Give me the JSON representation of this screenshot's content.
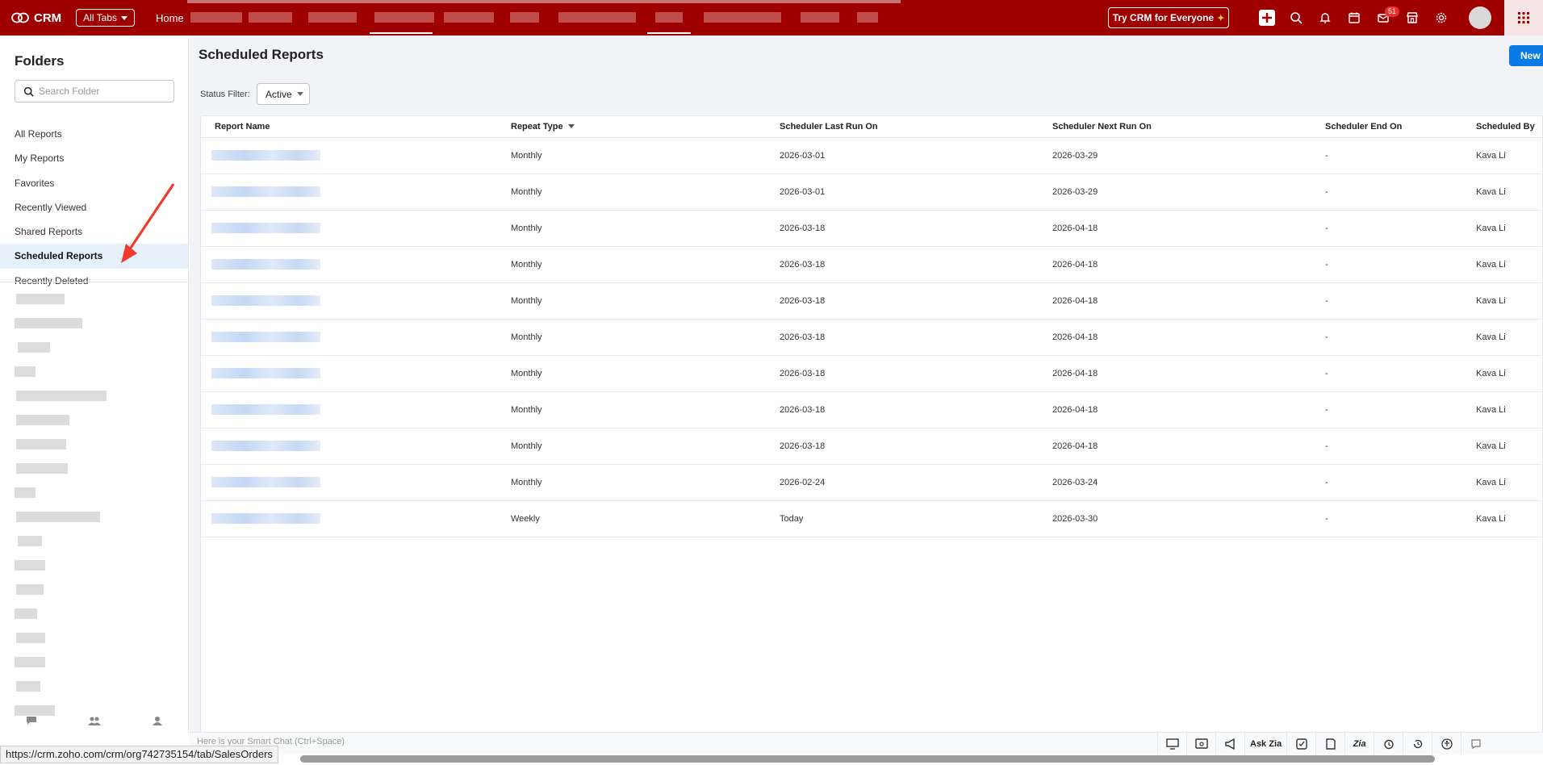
{
  "topbar": {
    "brand": "CRM",
    "all_tabs_label": "All Tabs",
    "home_label": "Home",
    "try_label": "Try CRM for Everyone",
    "notification_count": "51"
  },
  "sidebar": {
    "title": "Folders",
    "search_placeholder": "Search Folder",
    "items": [
      {
        "label": "All Reports"
      },
      {
        "label": "My Reports"
      },
      {
        "label": "Favorites"
      },
      {
        "label": "Recently Viewed"
      },
      {
        "label": "Shared Reports"
      },
      {
        "label": "Scheduled Reports"
      },
      {
        "label": "Recently Deleted"
      }
    ],
    "active_index": 5
  },
  "main": {
    "title": "Scheduled Reports",
    "new_button": "New",
    "status_filter_label": "Status Filter:",
    "status_filter_value": "Active"
  },
  "table": {
    "columns": [
      "Report Name",
      "Repeat Type",
      "Scheduler Last Run On",
      "Scheduler Next Run On",
      "Scheduler End On",
      "Scheduled By"
    ],
    "rows": [
      {
        "repeat": "Monthly",
        "last": "2026-03-01",
        "next": "2026-03-29",
        "end": "-",
        "by": "Kava Li"
      },
      {
        "repeat": "Monthly",
        "last": "2026-03-01",
        "next": "2026-03-29",
        "end": "-",
        "by": "Kava Li"
      },
      {
        "repeat": "Monthly",
        "last": "2026-03-18",
        "next": "2026-04-18",
        "end": "-",
        "by": "Kava Li"
      },
      {
        "repeat": "Monthly",
        "last": "2026-03-18",
        "next": "2026-04-18",
        "end": "-",
        "by": "Kava Li"
      },
      {
        "repeat": "Monthly",
        "last": "2026-03-18",
        "next": "2026-04-18",
        "end": "-",
        "by": "Kava Li"
      },
      {
        "repeat": "Monthly",
        "last": "2026-03-18",
        "next": "2026-04-18",
        "end": "-",
        "by": "Kava Li"
      },
      {
        "repeat": "Monthly",
        "last": "2026-03-18",
        "next": "2026-04-18",
        "end": "-",
        "by": "Kava Li"
      },
      {
        "repeat": "Monthly",
        "last": "2026-03-18",
        "next": "2026-04-18",
        "end": "-",
        "by": "Kava Li"
      },
      {
        "repeat": "Monthly",
        "last": "2026-03-18",
        "next": "2026-04-18",
        "end": "-",
        "by": "Kava Li"
      },
      {
        "repeat": "Monthly",
        "last": "2026-02-24",
        "next": "2026-03-24",
        "end": "-",
        "by": "Kava Li"
      },
      {
        "repeat": "Weekly",
        "last": "Today",
        "next": "2026-03-30",
        "end": "-",
        "by": "Kava Li"
      }
    ]
  },
  "bottom": {
    "smart_chat_placeholder": "Here is your Smart Chat (Ctrl+Space)",
    "ask_zia": "Ask Zia"
  },
  "status_url": "https://crm.zoho.com/crm/org742735154/tab/SalesOrders",
  "colors": {
    "brand": "#9e0000",
    "accent": "#0a7ae6",
    "active_row": "#e6f0fb"
  }
}
